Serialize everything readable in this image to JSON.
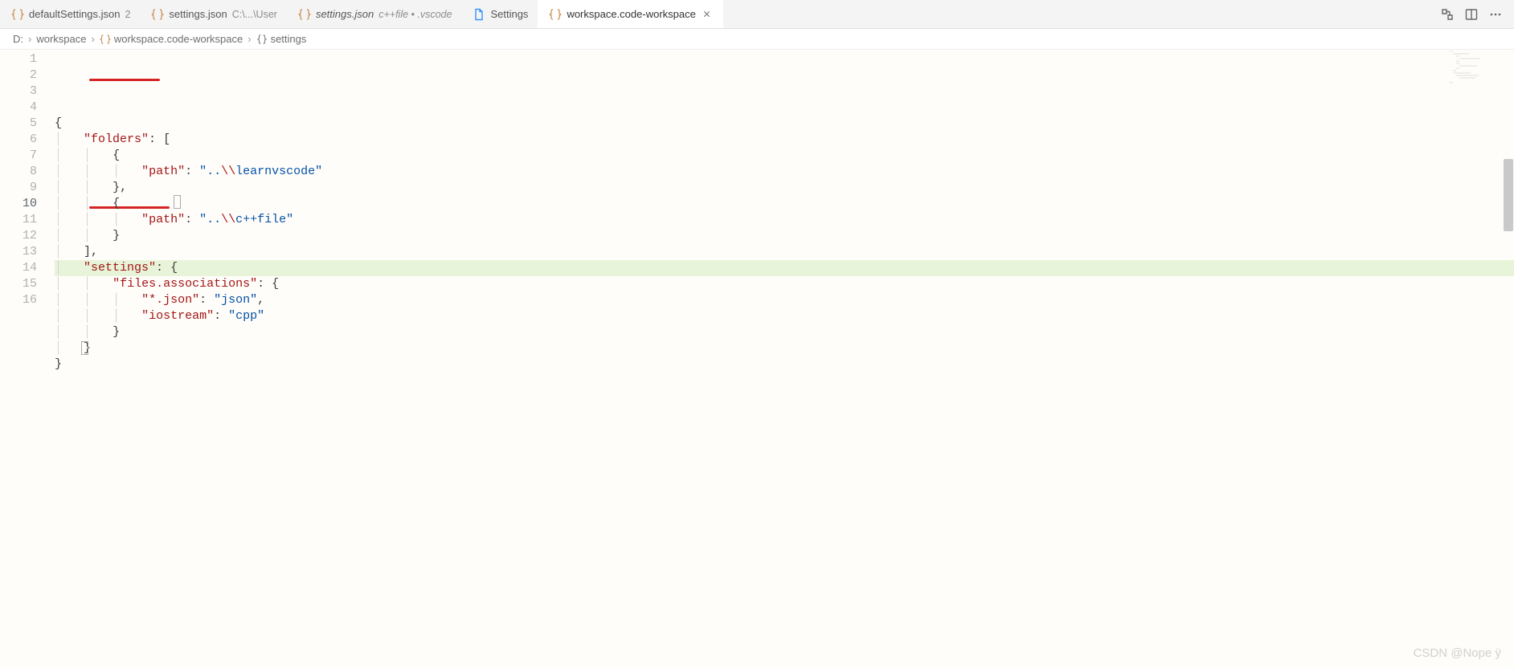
{
  "tabs": [
    {
      "icon": "json",
      "label": "defaultSettings.json",
      "hint": "2",
      "hint_italic": false,
      "label_italic": false,
      "active": false,
      "closeable": false
    },
    {
      "icon": "json",
      "label": "settings.json",
      "hint": "C:\\...\\User",
      "hint_italic": false,
      "label_italic": false,
      "active": false,
      "closeable": false
    },
    {
      "icon": "json",
      "label": "settings.json",
      "hint": "c++file • .vscode",
      "hint_italic": true,
      "label_italic": true,
      "active": false,
      "closeable": false
    },
    {
      "icon": "page",
      "label": "Settings",
      "hint": "",
      "hint_italic": false,
      "label_italic": false,
      "active": false,
      "closeable": false
    },
    {
      "icon": "json",
      "label": "workspace.code-workspace",
      "hint": "",
      "hint_italic": false,
      "label_italic": false,
      "active": true,
      "closeable": true
    }
  ],
  "tab_actions": {
    "compare": "compare-icon",
    "split": "split-editor-icon",
    "more": "more-icon"
  },
  "breadcrumbs": [
    {
      "icon": "",
      "label": "D:"
    },
    {
      "icon": "",
      "label": "workspace"
    },
    {
      "icon": "json",
      "label": "workspace.code-workspace"
    },
    {
      "icon": "braces",
      "label": "settings"
    }
  ],
  "code": {
    "current_line": 10,
    "lines": [
      {
        "n": 1,
        "indent": 0,
        "tokens": [
          {
            "t": "punc",
            "v": "{"
          }
        ]
      },
      {
        "n": 2,
        "indent": 1,
        "tokens": [
          {
            "t": "key",
            "v": "\"folders\""
          },
          {
            "t": "colon",
            "v": ": "
          },
          {
            "t": "punc",
            "v": "["
          }
        ]
      },
      {
        "n": 3,
        "indent": 2,
        "tokens": [
          {
            "t": "punc",
            "v": "{"
          }
        ]
      },
      {
        "n": 4,
        "indent": 3,
        "tokens": [
          {
            "t": "key",
            "v": "\"path\""
          },
          {
            "t": "colon",
            "v": ": "
          },
          {
            "t": "str",
            "v": "\".."
          },
          {
            "t": "esc",
            "v": "\\\\"
          },
          {
            "t": "str",
            "v": "learnvscode\""
          }
        ]
      },
      {
        "n": 5,
        "indent": 2,
        "tokens": [
          {
            "t": "punc",
            "v": "},"
          }
        ]
      },
      {
        "n": 6,
        "indent": 2,
        "tokens": [
          {
            "t": "punc",
            "v": "{"
          }
        ]
      },
      {
        "n": 7,
        "indent": 3,
        "tokens": [
          {
            "t": "key",
            "v": "\"path\""
          },
          {
            "t": "colon",
            "v": ": "
          },
          {
            "t": "str",
            "v": "\".."
          },
          {
            "t": "esc",
            "v": "\\\\"
          },
          {
            "t": "str",
            "v": "c++file\""
          }
        ]
      },
      {
        "n": 8,
        "indent": 2,
        "tokens": [
          {
            "t": "punc",
            "v": "}"
          }
        ]
      },
      {
        "n": 9,
        "indent": 1,
        "tokens": [
          {
            "t": "punc",
            "v": "],"
          }
        ]
      },
      {
        "n": 10,
        "indent": 1,
        "tokens": [
          {
            "t": "key",
            "v": "\"settings\""
          },
          {
            "t": "colon",
            "v": ": "
          },
          {
            "t": "punc",
            "v": "{"
          }
        ],
        "hl": true
      },
      {
        "n": 11,
        "indent": 2,
        "tokens": [
          {
            "t": "key",
            "v": "\"files.associations\""
          },
          {
            "t": "colon",
            "v": ": "
          },
          {
            "t": "punc",
            "v": "{"
          }
        ]
      },
      {
        "n": 12,
        "indent": 3,
        "tokens": [
          {
            "t": "key",
            "v": "\"*.json\""
          },
          {
            "t": "colon",
            "v": ": "
          },
          {
            "t": "str",
            "v": "\"json\""
          },
          {
            "t": "punc",
            "v": ","
          }
        ]
      },
      {
        "n": 13,
        "indent": 3,
        "tokens": [
          {
            "t": "key",
            "v": "\"iostream\""
          },
          {
            "t": "colon",
            "v": ": "
          },
          {
            "t": "str",
            "v": "\"cpp\""
          }
        ]
      },
      {
        "n": 14,
        "indent": 2,
        "tokens": [
          {
            "t": "punc",
            "v": "}"
          }
        ]
      },
      {
        "n": 15,
        "indent": 1,
        "tokens": [
          {
            "t": "punc",
            "v": "}"
          }
        ],
        "bracket_match": true
      },
      {
        "n": 16,
        "indent": 0,
        "tokens": [
          {
            "t": "punc",
            "v": "}"
          }
        ]
      }
    ]
  },
  "watermark": "CSDN @Nope ÿ"
}
